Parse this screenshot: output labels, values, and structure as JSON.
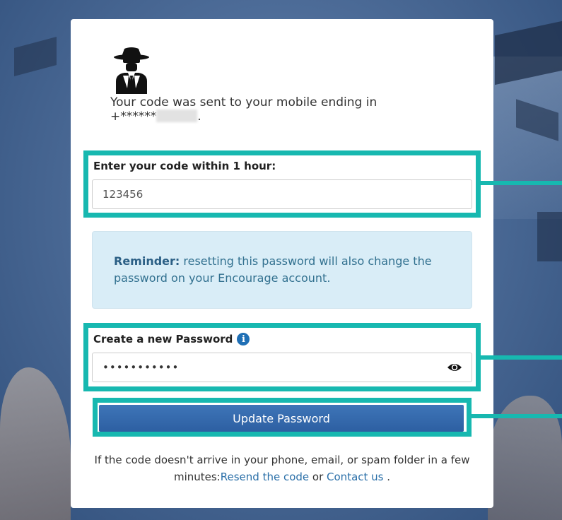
{
  "page": {
    "message_line1": "Your code was sent to your mobile ending in",
    "masked_phone": "+******",
    "masked_phone_end": "."
  },
  "code": {
    "label": "Enter your code within 1 hour:",
    "value": "123456"
  },
  "reminder": {
    "bold": "Reminder:",
    "text": " resetting this password will also change the password on your Encourage account."
  },
  "password": {
    "label": "Create a new Password",
    "value": "•••••••••••",
    "info_icon": "info-icon",
    "toggle_icon": "eye-icon"
  },
  "actions": {
    "update_label": "Update Password"
  },
  "footer": {
    "text_before": "If the code doesn't arrive in your phone, email, or spam folder in a few minutes:",
    "resend_link": "Resend the code",
    "or_text": " or ",
    "contact_link": "Contact us",
    "end": " ."
  },
  "colors": {
    "highlight": "#17b8b0",
    "button": "#3e75b8",
    "reminder_bg": "#d9edf7",
    "link": "#2a6fa8"
  }
}
